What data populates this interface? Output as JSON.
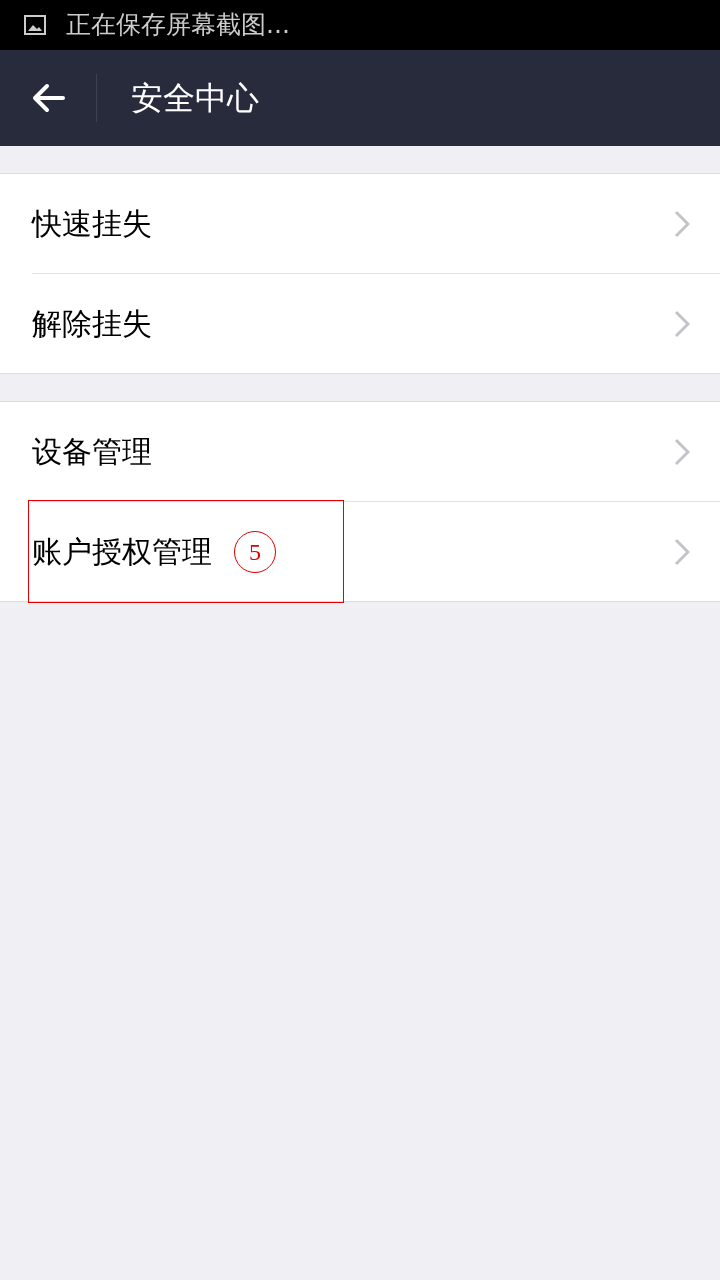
{
  "status_bar": {
    "text": "正在保存屏幕截图..."
  },
  "header": {
    "title": "安全中心"
  },
  "groups": [
    {
      "items": [
        {
          "label": "快速挂失"
        },
        {
          "label": "解除挂失"
        }
      ]
    },
    {
      "items": [
        {
          "label": "设备管理"
        },
        {
          "label": "账户授权管理",
          "annotation": "5"
        }
      ]
    }
  ]
}
